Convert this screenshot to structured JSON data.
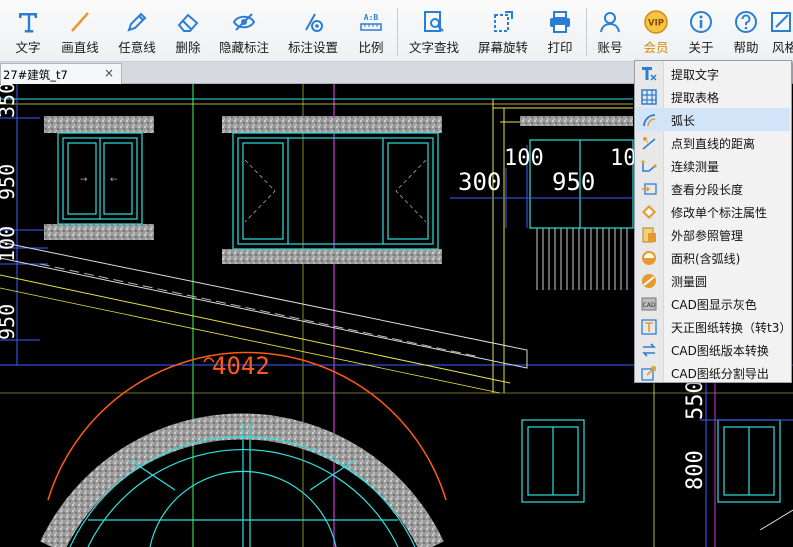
{
  "toolbar": {
    "buttons": [
      {
        "label": "文字",
        "icon": "text-icon"
      },
      {
        "label": "画直线",
        "icon": "line-icon"
      },
      {
        "label": "任意线",
        "icon": "pen-icon"
      },
      {
        "label": "删除",
        "icon": "eraser-icon"
      },
      {
        "label": "隐藏标注",
        "icon": "eye-icon"
      },
      {
        "label": "标注设置",
        "icon": "settings-icon"
      },
      {
        "label": "比例",
        "icon": "scale-icon"
      },
      {
        "label": "文字查找",
        "icon": "find-text-icon"
      },
      {
        "label": "屏幕旋转",
        "icon": "rotate-icon"
      },
      {
        "label": "打印",
        "icon": "printer-icon"
      },
      {
        "label": "账号",
        "icon": "user-icon"
      },
      {
        "label": "会员",
        "icon": "vip-icon",
        "icon_text": "VIP"
      },
      {
        "label": "关于",
        "icon": "info-icon"
      },
      {
        "label": "帮助",
        "icon": "help-icon"
      },
      {
        "label": "风格",
        "icon": "style-icon"
      }
    ]
  },
  "tab": {
    "title": "27#建筑_t7",
    "close": "×"
  },
  "drawing": {
    "dimensions": [
      "100",
      "10",
      "300",
      "950",
      "4042",
      "350",
      "950",
      "100",
      "950",
      "550",
      "800"
    ],
    "scale_icon_text": "A:B",
    "colors": {
      "background": "#000000",
      "wall_cyan": "#2fe0e0",
      "dim_yellow": "#e8e14a",
      "guide_green": "#34d34a",
      "guide_magenta": "#d238d8",
      "arc_orange": "#ff5a1a",
      "dim_blue": "#3b5cff"
    }
  },
  "context_menu": {
    "items": [
      {
        "label": "提取文字",
        "icon": "extract-text-icon"
      },
      {
        "label": "提取表格",
        "icon": "extract-table-icon"
      },
      {
        "label": "弧长",
        "icon": "arc-length-icon",
        "highlighted": true
      },
      {
        "label": "点到直线的距离",
        "icon": "point-line-distance-icon"
      },
      {
        "label": "连续测量",
        "icon": "continuous-measure-icon"
      },
      {
        "label": "查看分段长度",
        "icon": "segment-length-icon"
      },
      {
        "label": "修改单个标注属性",
        "icon": "edit-dimension-icon"
      },
      {
        "label": "外部参照管理",
        "icon": "xref-icon"
      },
      {
        "label": "面积(含弧线)",
        "icon": "area-icon"
      },
      {
        "label": "测量圆",
        "icon": "measure-circle-icon"
      },
      {
        "label": "CAD图显示灰色",
        "icon": "gray-display-icon"
      },
      {
        "label": "天正图纸转换（转t3）",
        "icon": "tangent-convert-icon"
      },
      {
        "label": "CAD图纸版本转换",
        "icon": "version-convert-icon"
      },
      {
        "label": "CAD图纸分割导出",
        "icon": "split-export-icon"
      }
    ]
  }
}
